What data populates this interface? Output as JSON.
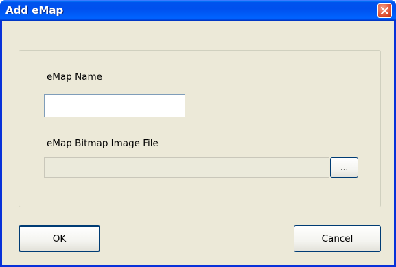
{
  "window": {
    "title": "Add eMap",
    "close_icon": "close-icon"
  },
  "form": {
    "name_label": "eMap Name",
    "name_value": "",
    "file_label": "eMap Bitmap Image File",
    "file_value": "",
    "browse_label": "..."
  },
  "buttons": {
    "ok_label": "OK",
    "cancel_label": "Cancel"
  },
  "colors": {
    "titlebar": "#0054e3",
    "dialog_background": "#ece9d8",
    "close_button": "#e2573a"
  }
}
